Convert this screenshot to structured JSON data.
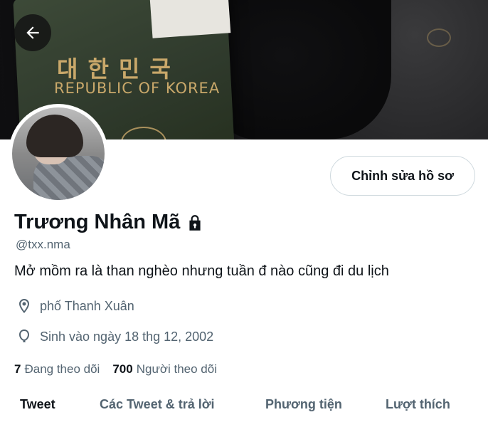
{
  "banner": {
    "korean_title": "대한민국",
    "english_title": "REPUBLIC OF KOREA"
  },
  "header": {
    "back_icon": "arrow-left-icon"
  },
  "profile": {
    "edit_button_label": "Chỉnh sửa hồ sơ",
    "display_name": "Trương Nhân Mã",
    "lock_icon": "lock-icon",
    "handle": "@txx.nma",
    "bio": "Mở mồm ra là than nghèo nhưng tuần đ nào cũng đi du lịch",
    "location": "phố Thanh Xuân",
    "birthday": "Sinh vào ngày 18 thg 12, 2002",
    "following_count": "7",
    "following_label": "Đang theo dõi",
    "followers_count": "700",
    "followers_label": "Người theo dõi"
  },
  "tabs": [
    {
      "label": "Tweet",
      "active": true
    },
    {
      "label": "Các Tweet & trả lời",
      "active": false
    },
    {
      "label": "Phương tiện",
      "active": false
    },
    {
      "label": "Lượt thích",
      "active": false
    }
  ],
  "colors": {
    "primary_text": "#0f1419",
    "secondary_text": "#536471",
    "border": "#cfd9de",
    "passport_gold": "#c9a86a",
    "passport_green": "#2f3a2c"
  }
}
